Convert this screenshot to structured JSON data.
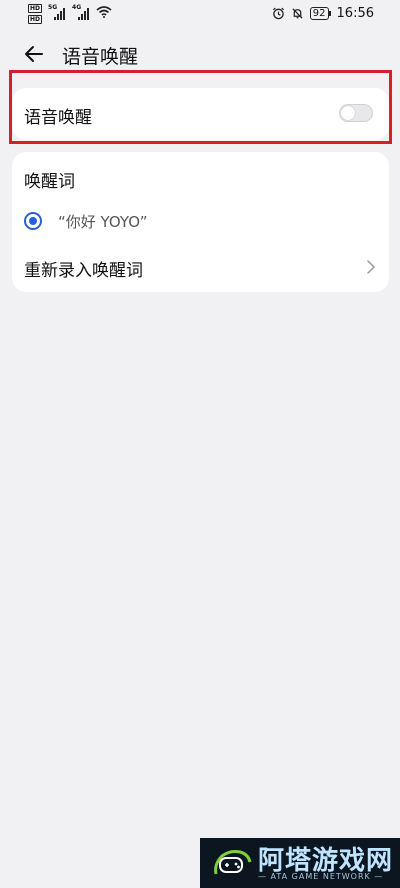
{
  "status_bar": {
    "hd_badge_1": "HD",
    "hd_badge_2": "HD",
    "network_1": "5G",
    "network_2": "4G",
    "battery": "92",
    "time": "16:56"
  },
  "header": {
    "title": "语音唤醒"
  },
  "voice_wakeup": {
    "label": "语音唤醒",
    "enabled": false
  },
  "wake_word_section": {
    "title": "唤醒词",
    "option_label": "“你好 YOYO”",
    "option_selected": true,
    "rerecord_label": "重新录入唤醒词"
  },
  "watermark": {
    "title": "阿塔游戏网",
    "subtitle": "— ATA GAME NETWORK —"
  },
  "colors": {
    "background": "#f1f1f3",
    "card": "#ffffff",
    "accent": "#2a5fd9",
    "highlight": "#d3202a"
  }
}
